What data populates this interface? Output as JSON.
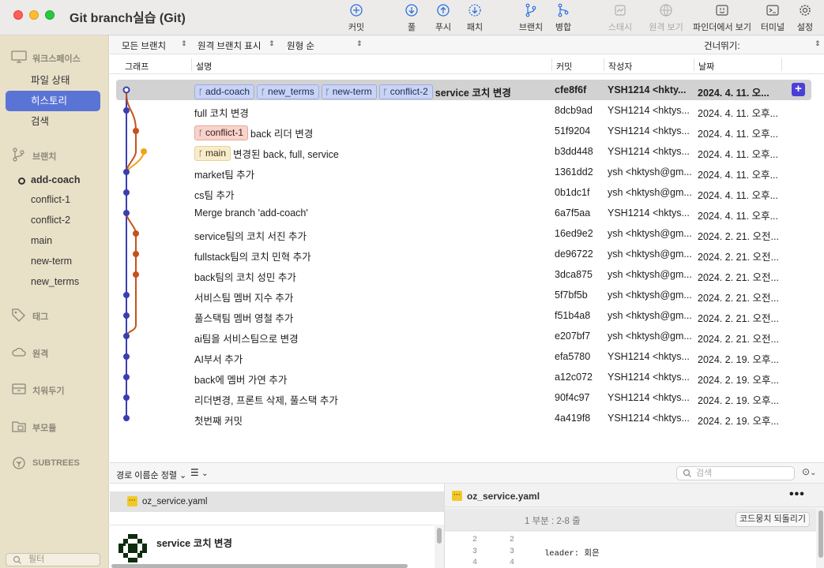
{
  "app": {
    "title": "Git branch실습 (Git)"
  },
  "toolbar": {
    "commit": "커밋",
    "pull": "풀",
    "push": "푸시",
    "fetch": "패치",
    "branch": "브랜치",
    "merge": "병합",
    "stash": "스태시",
    "remote_view": "원격 보기",
    "finder": "파인더에서 보기",
    "terminal": "터미널",
    "settings": "설정"
  },
  "sidebar": {
    "workspace": {
      "label": "워크스페이스",
      "items": [
        {
          "label": "파일 상태",
          "active": false
        },
        {
          "label": "히스토리",
          "active": true
        },
        {
          "label": "검색",
          "active": false
        }
      ]
    },
    "branches": {
      "label": "브랜치",
      "items": [
        {
          "label": "add-coach",
          "current": true
        },
        {
          "label": "conflict-1",
          "current": false
        },
        {
          "label": "conflict-2",
          "current": false
        },
        {
          "label": "main",
          "current": false
        },
        {
          "label": "new-term",
          "current": false
        },
        {
          "label": "new_terms",
          "current": false
        }
      ]
    },
    "tags": "태그",
    "remotes": "원격",
    "stashes": "치워두기",
    "submodules": "부모듈",
    "subtrees": "SUBTREES",
    "filter_placeholder": "필터"
  },
  "filterbar": {
    "branches": "모든 브랜치",
    "remote_branches": "원격 브랜치 표시",
    "order": "원형 순",
    "jump": "건너뛰기:"
  },
  "columns": {
    "graph": "그래프",
    "description": "설명",
    "commit": "커밋",
    "author": "작성자",
    "date": "날짜"
  },
  "commits": [
    {
      "tags": [
        {
          "name": "add-coach",
          "color": "blue"
        },
        {
          "name": "new_terms",
          "color": "blue"
        },
        {
          "name": "new-term",
          "color": "blue"
        },
        {
          "name": "conflict-2",
          "color": "blue"
        }
      ],
      "message": "service  코치 변경",
      "hash": "cfe8f6f",
      "author": "YSH1214 <hkty...",
      "date": "2024. 4. 11. 오...",
      "selected": true
    },
    {
      "tags": [],
      "message": "full 코치 변경",
      "hash": "8dcb9ad",
      "author": "YSH1214 <hktys...",
      "date": "2024. 4. 11. 오후...",
      "selected": false
    },
    {
      "tags": [
        {
          "name": "conflict-1",
          "color": "red"
        }
      ],
      "message": "back 리더 변경",
      "hash": "51f9204",
      "author": "YSH1214 <hktys...",
      "date": "2024. 4. 11. 오후...",
      "selected": false
    },
    {
      "tags": [
        {
          "name": "main",
          "color": "yellow"
        }
      ],
      "message": "변경된 back, full, service",
      "hash": "b3dd448",
      "author": "YSH1214 <hktys...",
      "date": "2024. 4. 11. 오후...",
      "selected": false
    },
    {
      "tags": [],
      "message": "market팀 추가",
      "hash": "1361dd2",
      "author": "ysh <hktysh@gm...",
      "date": "2024. 4. 11. 오후...",
      "selected": false
    },
    {
      "tags": [],
      "message": "cs팀 추가",
      "hash": "0b1dc1f",
      "author": "ysh <hktysh@gm...",
      "date": "2024. 4. 11. 오후...",
      "selected": false
    },
    {
      "tags": [],
      "message": "Merge branch 'add-coach'",
      "hash": "6a7f5aa",
      "author": "YSH1214 <hktys...",
      "date": "2024. 4. 11. 오후...",
      "selected": false
    },
    {
      "tags": [],
      "message": "service팀의 코치 서진 추가",
      "hash": "16ed9e2",
      "author": "ysh <hktysh@gm...",
      "date": "2024. 2. 21. 오전...",
      "selected": false
    },
    {
      "tags": [],
      "message": "fullstack팀의 코치 민혁 추가",
      "hash": "de96722",
      "author": "ysh <hktysh@gm...",
      "date": "2024. 2. 21. 오전...",
      "selected": false
    },
    {
      "tags": [],
      "message": "back팀의 코치 성민 추가",
      "hash": "3dca875",
      "author": "ysh <hktysh@gm...",
      "date": "2024. 2. 21. 오전...",
      "selected": false
    },
    {
      "tags": [],
      "message": "서비스팀 멤버 지수 추가",
      "hash": "5f7bf5b",
      "author": "ysh <hktysh@gm...",
      "date": "2024. 2. 21. 오전...",
      "selected": false
    },
    {
      "tags": [],
      "message": "풀스택팀 멤버 영철 추가",
      "hash": "f51b4a8",
      "author": "ysh <hktysh@gm...",
      "date": "2024. 2. 21. 오전...",
      "selected": false
    },
    {
      "tags": [],
      "message": "ai팀을 서비스팀으로 변경",
      "hash": "e207bf7",
      "author": "ysh <hktysh@gm...",
      "date": "2024. 2. 21. 오전...",
      "selected": false
    },
    {
      "tags": [],
      "message": "AI부서 추가",
      "hash": "efa5780",
      "author": "YSH1214 <hktys...",
      "date": "2024. 2. 19. 오후...",
      "selected": false
    },
    {
      "tags": [],
      "message": "back에 멤버 가연 추가",
      "hash": "a12c072",
      "author": "YSH1214 <hktys...",
      "date": "2024. 2. 19. 오후...",
      "selected": false
    },
    {
      "tags": [],
      "message": "리더변경, 프론트 삭제, 풀스택 추가",
      "hash": "90f4c97",
      "author": "YSH1214 <hktys...",
      "date": "2024. 2. 19. 오후...",
      "selected": false
    },
    {
      "tags": [],
      "message": "첫번째 커밋",
      "hash": "4a419f8",
      "author": "YSH1214 <hktys...",
      "date": "2024. 2. 19. 오후...",
      "selected": false
    }
  ],
  "graph_colors": {
    "main_line": "#3a3fb0",
    "branch_red": "#c4521e",
    "branch_yellow": "#f0a21a"
  },
  "bottom": {
    "sort_label": "경로 이름순 정렬",
    "search_placeholder": "검색",
    "file": "oz_service.yaml",
    "commit_message": "service 코치 변경",
    "diff": {
      "file": "oz_service.yaml",
      "menu": "•••",
      "hunk": "1 부분 : 2-8 줄",
      "revert": "코드뭉치 되돌리기",
      "lines": [
        {
          "old": "2",
          "new": "2",
          "code": ""
        },
        {
          "old": "3",
          "new": "3",
          "code": "leader: 회은"
        },
        {
          "old": "4",
          "new": "4",
          "code": ""
        }
      ]
    }
  }
}
